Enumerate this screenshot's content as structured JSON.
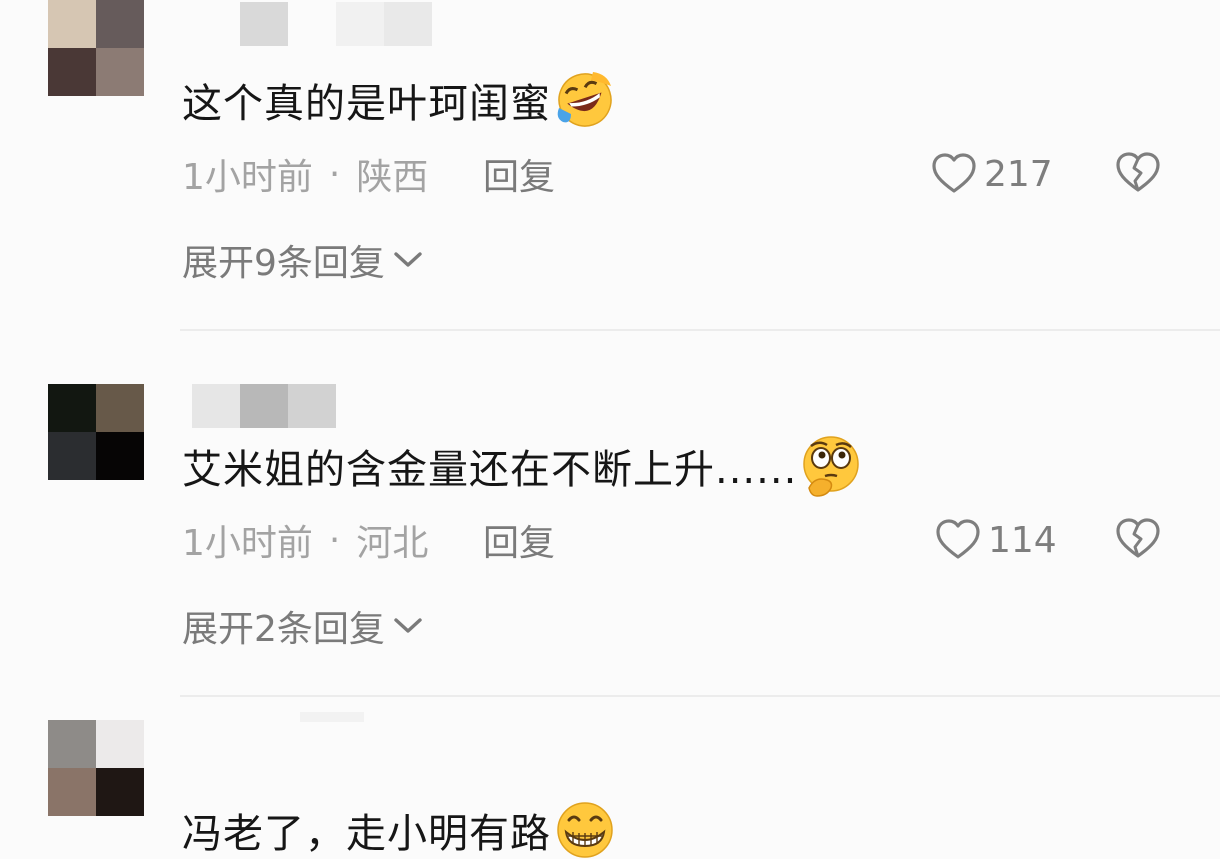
{
  "comments": [
    {
      "text": "这个真的是叶珂闺蜜",
      "emoji": "rolling-laughing-emoji",
      "time": "1小时前",
      "dot": "·",
      "location": "陕西",
      "reply": "回复",
      "likes": "217",
      "expand": "展开9条回复"
    },
    {
      "text": "艾米姐的含金量还在不断上升......",
      "emoji": "thinking-eyes-emoji",
      "time": "1小时前",
      "dot": "·",
      "location": "河北",
      "reply": "回复",
      "likes": "114",
      "expand": "展开2条回复"
    },
    {
      "text": "冯老了，走小明有路",
      "emoji": "grinning-emoji"
    }
  ],
  "icons": {
    "like": "heart-icon",
    "dislike": "broken-heart-icon",
    "expand": "chevron-down-icon"
  },
  "colors": {
    "text": "#161616",
    "meta": "#a3a3a3",
    "action": "#7a7a7a",
    "divider": "#ececec"
  }
}
